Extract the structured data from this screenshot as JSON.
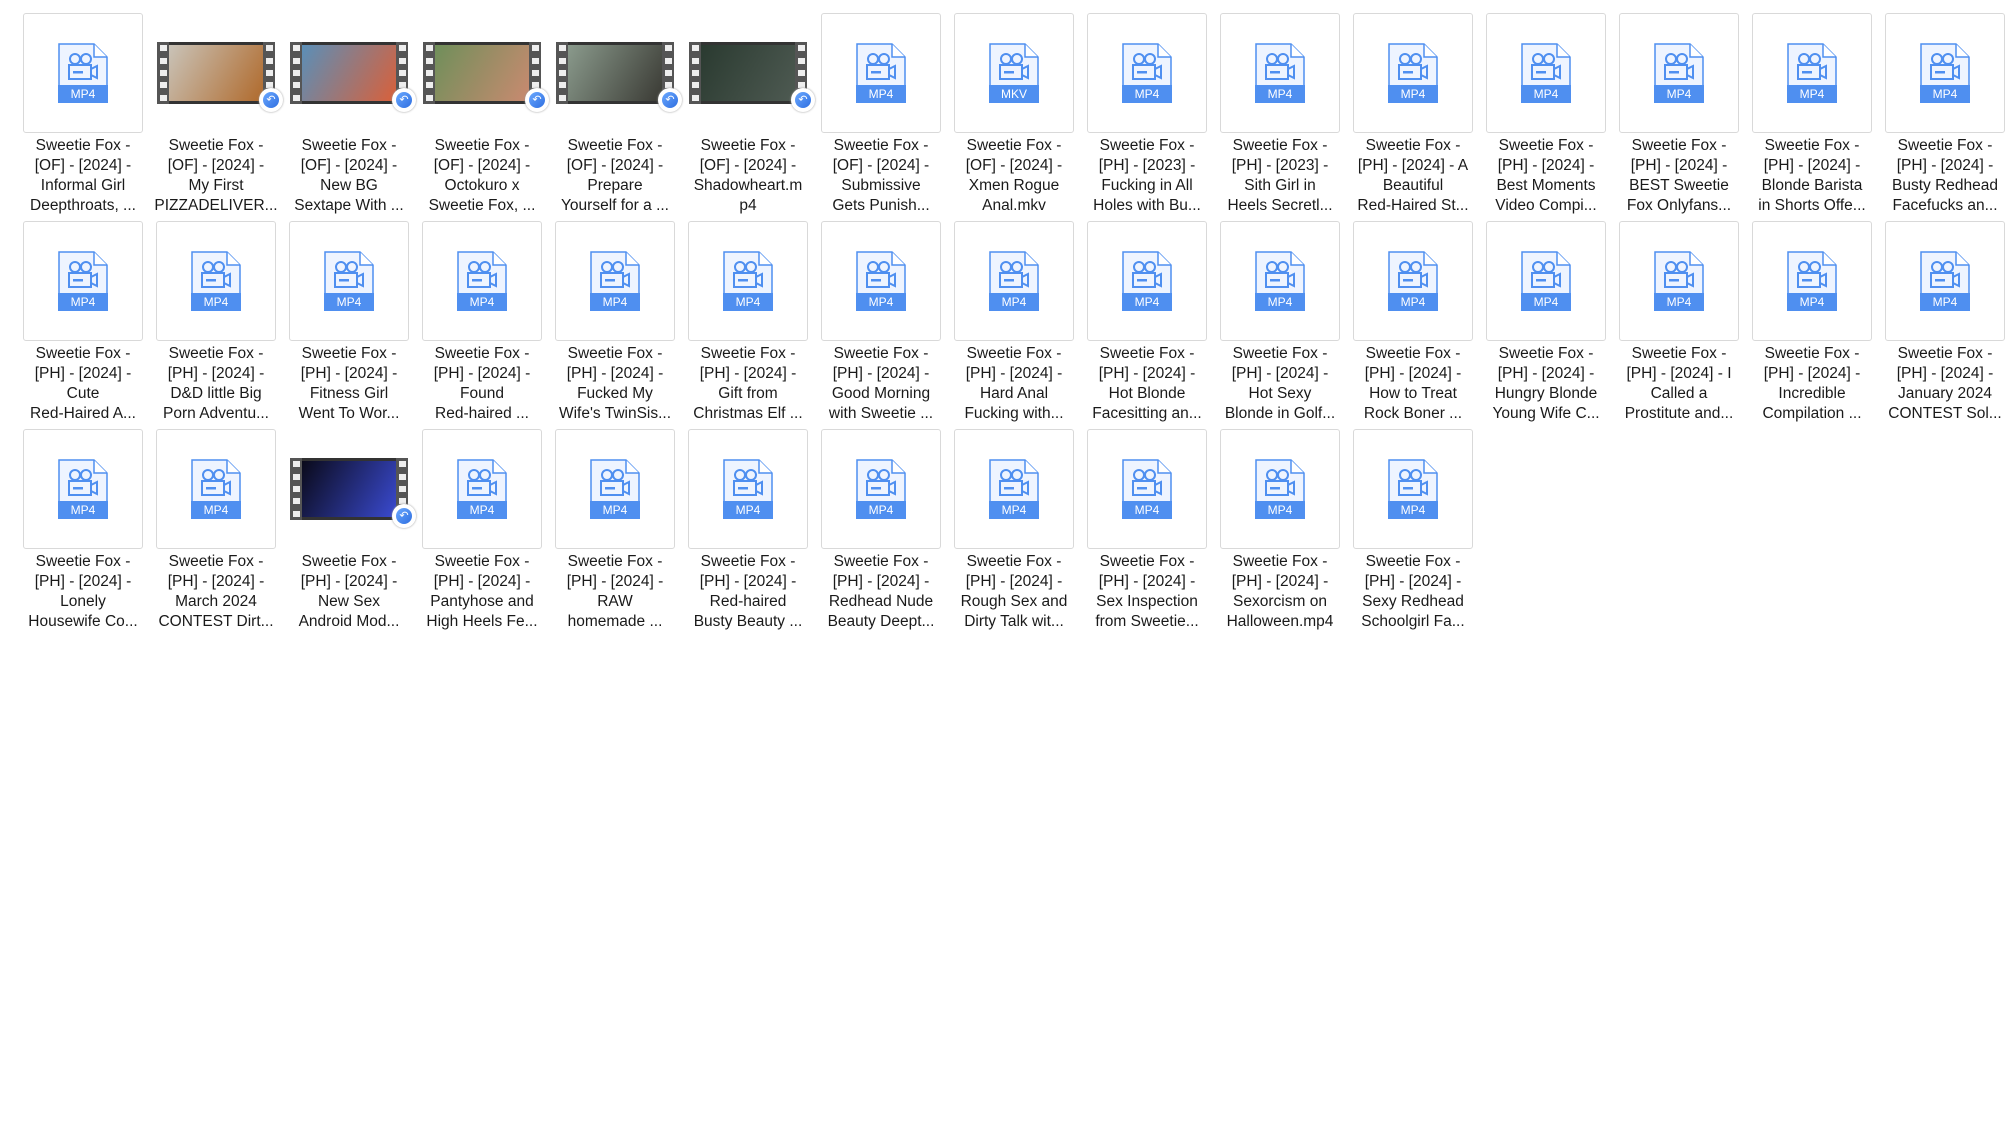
{
  "accent_color": "#4f8ff0",
  "items": [
    {
      "ext": "MP4",
      "lines": [
        "Sweetie Fox -",
        "[OF] - [2024] -",
        "Informal Girl",
        "Deepthroats, ..."
      ]
    },
    {
      "ext": "MP4",
      "thumb": [
        "#c9c3b8",
        "#b06a2c"
      ],
      "lines": [
        "Sweetie Fox -",
        "[OF] - [2024] -",
        "My First",
        "PIZZADELIVER..."
      ]
    },
    {
      "ext": "MP4",
      "thumb": [
        "#5a8fb8",
        "#d9603a"
      ],
      "lines": [
        "Sweetie Fox -",
        "[OF] - [2024] -",
        "New BG",
        "Sextape With ..."
      ]
    },
    {
      "ext": "MP4",
      "thumb": [
        "#6f8f5a",
        "#c98a70"
      ],
      "lines": [
        "Sweetie Fox -",
        "[OF] - [2024] -",
        "Octokuro x",
        "Sweetie Fox, ..."
      ]
    },
    {
      "ext": "MP4",
      "thumb": [
        "#8a9a8c",
        "#3a3a34"
      ],
      "lines": [
        "Sweetie Fox -",
        "[OF] - [2024] -",
        "Prepare",
        "Yourself for a ..."
      ]
    },
    {
      "ext": "MP4",
      "thumb": [
        "#2a3a30",
        "#4e5a52"
      ],
      "lines": [
        "Sweetie Fox -",
        "[OF] - [2024] -",
        "Shadowheart.m",
        "p4"
      ]
    },
    {
      "ext": "MP4",
      "lines": [
        "Sweetie Fox -",
        "[OF] - [2024] -",
        "Submissive",
        "Gets Punish..."
      ]
    },
    {
      "ext": "MKV",
      "lines": [
        "Sweetie Fox -",
        "[OF] - [2024] -",
        "Xmen Rogue",
        "Anal.mkv"
      ]
    },
    {
      "ext": "MP4",
      "lines": [
        "Sweetie Fox -",
        "[PH] - [2023] -",
        "Fucking in All",
        "Holes with Bu..."
      ]
    },
    {
      "ext": "MP4",
      "lines": [
        "Sweetie Fox -",
        "[PH] - [2023] -",
        "Sith Girl in",
        "Heels Secretl..."
      ]
    },
    {
      "ext": "MP4",
      "lines": [
        "Sweetie Fox -",
        "[PH] - [2024] - A",
        "Beautiful",
        "Red-Haired St..."
      ]
    },
    {
      "ext": "MP4",
      "lines": [
        "Sweetie Fox -",
        "[PH] - [2024] -",
        "Best Moments",
        "Video Compi..."
      ]
    },
    {
      "ext": "MP4",
      "lines": [
        "Sweetie Fox -",
        "[PH] - [2024] -",
        "BEST Sweetie",
        "Fox Onlyfans..."
      ]
    },
    {
      "ext": "MP4",
      "lines": [
        "Sweetie Fox -",
        "[PH] - [2024] -",
        "Blonde Barista",
        "in Shorts Offe..."
      ]
    },
    {
      "ext": "MP4",
      "lines": [
        "Sweetie Fox -",
        "[PH] - [2024] -",
        "Busty Redhead",
        "Facefucks an..."
      ]
    },
    {
      "ext": "MP4",
      "lines": [
        "Sweetie Fox -",
        "[PH] - [2024] -",
        "Cute",
        "Red-Haired A..."
      ]
    },
    {
      "ext": "MP4",
      "lines": [
        "Sweetie Fox -",
        "[PH] - [2024] -",
        "D&D little Big",
        "Porn Adventu..."
      ]
    },
    {
      "ext": "MP4",
      "lines": [
        "Sweetie Fox -",
        "[PH] - [2024] -",
        "Fitness Girl",
        "Went To Wor..."
      ]
    },
    {
      "ext": "MP4",
      "lines": [
        "Sweetie Fox -",
        "[PH] - [2024] -",
        "Found",
        "Red-haired ..."
      ]
    },
    {
      "ext": "MP4",
      "lines": [
        "Sweetie Fox -",
        "[PH] - [2024] -",
        "Fucked My",
        "Wife's TwinSis..."
      ]
    },
    {
      "ext": "MP4",
      "lines": [
        "Sweetie Fox -",
        "[PH] - [2024] -",
        "Gift from",
        "Christmas Elf ..."
      ]
    },
    {
      "ext": "MP4",
      "lines": [
        "Sweetie Fox -",
        "[PH] - [2024] -",
        "Good Morning",
        "with Sweetie ..."
      ]
    },
    {
      "ext": "MP4",
      "lines": [
        "Sweetie Fox -",
        "[PH] - [2024] -",
        "Hard Anal",
        "Fucking with..."
      ]
    },
    {
      "ext": "MP4",
      "lines": [
        "Sweetie Fox -",
        "[PH] - [2024] -",
        "Hot Blonde",
        "Facesitting an..."
      ]
    },
    {
      "ext": "MP4",
      "lines": [
        "Sweetie Fox -",
        "[PH] - [2024] -",
        "Hot Sexy",
        "Blonde in Golf..."
      ]
    },
    {
      "ext": "MP4",
      "lines": [
        "Sweetie Fox -",
        "[PH] - [2024] -",
        "How to Treat",
        "Rock Boner ..."
      ]
    },
    {
      "ext": "MP4",
      "lines": [
        "Sweetie Fox -",
        "[PH] - [2024] -",
        "Hungry Blonde",
        "Young Wife C..."
      ]
    },
    {
      "ext": "MP4",
      "lines": [
        "Sweetie Fox -",
        "[PH] - [2024] - I",
        "Called a",
        "Prostitute and..."
      ]
    },
    {
      "ext": "MP4",
      "lines": [
        "Sweetie Fox -",
        "[PH] - [2024] -",
        "Incredible",
        "Compilation ..."
      ]
    },
    {
      "ext": "MP4",
      "lines": [
        "Sweetie Fox -",
        "[PH] - [2024] -",
        "January 2024",
        "CONTEST Sol..."
      ]
    },
    {
      "ext": "MP4",
      "lines": [
        "Sweetie Fox -",
        "[PH] - [2024] -",
        "Lonely",
        "Housewife Co..."
      ]
    },
    {
      "ext": "MP4",
      "lines": [
        "Sweetie Fox -",
        "[PH] - [2024] -",
        "March 2024",
        "CONTEST Dirt..."
      ]
    },
    {
      "ext": "MP4",
      "thumb": [
        "#0a0a1a",
        "#3a4ad0"
      ],
      "lines": [
        "Sweetie Fox -",
        "[PH] - [2024] -",
        "New Sex",
        "Android Mod..."
      ]
    },
    {
      "ext": "MP4",
      "lines": [
        "Sweetie Fox -",
        "[PH] - [2024] -",
        "Pantyhose and",
        "High Heels Fe..."
      ]
    },
    {
      "ext": "MP4",
      "lines": [
        "Sweetie Fox -",
        "[PH] - [2024] -",
        "RAW",
        "homemade ..."
      ]
    },
    {
      "ext": "MP4",
      "lines": [
        "Sweetie Fox -",
        "[PH] - [2024] -",
        "Red-haired",
        "Busty Beauty ..."
      ]
    },
    {
      "ext": "MP4",
      "lines": [
        "Sweetie Fox -",
        "[PH] - [2024] -",
        "Redhead Nude",
        "Beauty Deept..."
      ]
    },
    {
      "ext": "MP4",
      "lines": [
        "Sweetie Fox -",
        "[PH] - [2024] -",
        "Rough Sex and",
        "Dirty Talk wit..."
      ]
    },
    {
      "ext": "MP4",
      "lines": [
        "Sweetie Fox -",
        "[PH] - [2024] -",
        "Sex Inspection",
        "from Sweetie..."
      ]
    },
    {
      "ext": "MP4",
      "lines": [
        "Sweetie Fox -",
        "[PH] - [2024] -",
        "Sexorcism on",
        "Halloween.mp4"
      ]
    },
    {
      "ext": "MP4",
      "lines": [
        "Sweetie Fox -",
        "[PH] - [2024] -",
        "Sexy Redhead",
        "Schoolgirl Fa..."
      ]
    }
  ]
}
